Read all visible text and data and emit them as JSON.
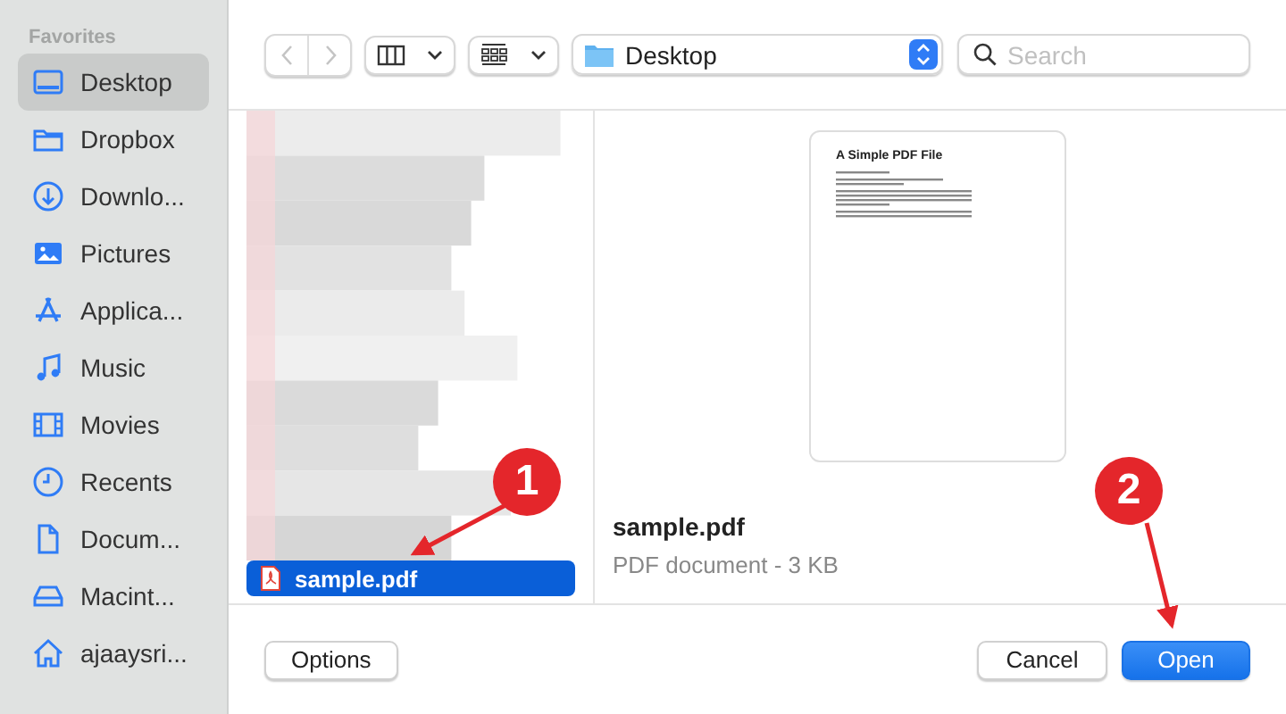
{
  "sidebar": {
    "header": "Favorites",
    "items": [
      {
        "label": "Desktop",
        "kind": "desktop",
        "selected": true
      },
      {
        "label": "Dropbox",
        "kind": "folder",
        "selected": false
      },
      {
        "label": "Downlo...",
        "kind": "download",
        "selected": false
      },
      {
        "label": "Pictures",
        "kind": "pictures",
        "selected": false
      },
      {
        "label": "Applica...",
        "kind": "apps",
        "selected": false
      },
      {
        "label": "Music",
        "kind": "music",
        "selected": false
      },
      {
        "label": "Movies",
        "kind": "movies",
        "selected": false
      },
      {
        "label": "Recents",
        "kind": "clock",
        "selected": false
      },
      {
        "label": "Docum...",
        "kind": "document",
        "selected": false
      },
      {
        "label": "Macint...",
        "kind": "disk",
        "selected": false
      },
      {
        "label": "ajaaysri...",
        "kind": "home",
        "selected": false
      }
    ]
  },
  "toolbar": {
    "location": "Desktop",
    "search": {
      "placeholder": "Search"
    }
  },
  "file_list": {
    "items": [
      {
        "name": "sample.pdf",
        "selected": true
      }
    ]
  },
  "preview": {
    "document_title": "A Simple PDF File",
    "name": "sample.pdf",
    "details": "PDF document - 3 KB"
  },
  "buttons": {
    "left": [
      {
        "label": "Options",
        "kind": "secondary"
      }
    ],
    "right": [
      {
        "label": "Cancel",
        "kind": "secondary"
      },
      {
        "label": "Open",
        "kind": "primary"
      }
    ]
  },
  "annotations": [
    {
      "label": "1"
    },
    {
      "label": "2"
    }
  ]
}
